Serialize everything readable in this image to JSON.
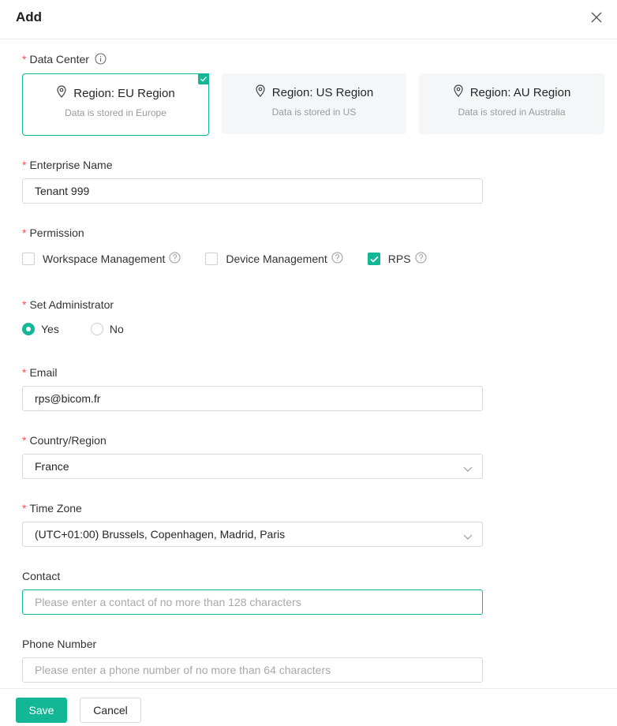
{
  "dialog": {
    "title": "Add"
  },
  "data_center": {
    "label": "Data Center",
    "regions": [
      {
        "title": "Region: EU Region",
        "desc": "Data is stored in Europe",
        "selected": true
      },
      {
        "title": "Region: US Region",
        "desc": "Data is stored in US",
        "selected": false
      },
      {
        "title": "Region: AU Region",
        "desc": "Data is stored in Australia",
        "selected": false
      }
    ]
  },
  "enterprise": {
    "label": "Enterprise Name",
    "value": "Tenant 999"
  },
  "permission": {
    "label": "Permission",
    "options": [
      {
        "label": "Workspace Management",
        "checked": false
      },
      {
        "label": "Device Management",
        "checked": false
      },
      {
        "label": "RPS",
        "checked": true
      }
    ]
  },
  "administrator": {
    "label": "Set Administrator",
    "options": [
      {
        "label": "Yes",
        "checked": true
      },
      {
        "label": "No",
        "checked": false
      }
    ]
  },
  "email": {
    "label": "Email",
    "value": "rps@bicom.fr"
  },
  "country": {
    "label": "Country/Region",
    "value": "France"
  },
  "timezone": {
    "label": "Time Zone",
    "value": "(UTC+01:00) Brussels, Copenhagen, Madrid, Paris"
  },
  "contact": {
    "label": "Contact",
    "placeholder": "Please enter a contact of no more than 128 characters"
  },
  "phone": {
    "label": "Phone Number",
    "placeholder": "Please enter a phone number of no more than 64 characters"
  },
  "footer": {
    "save_label": "Save",
    "cancel_label": "Cancel"
  },
  "colors": {
    "accent": "#13b796",
    "required": "#ff4d4f"
  }
}
